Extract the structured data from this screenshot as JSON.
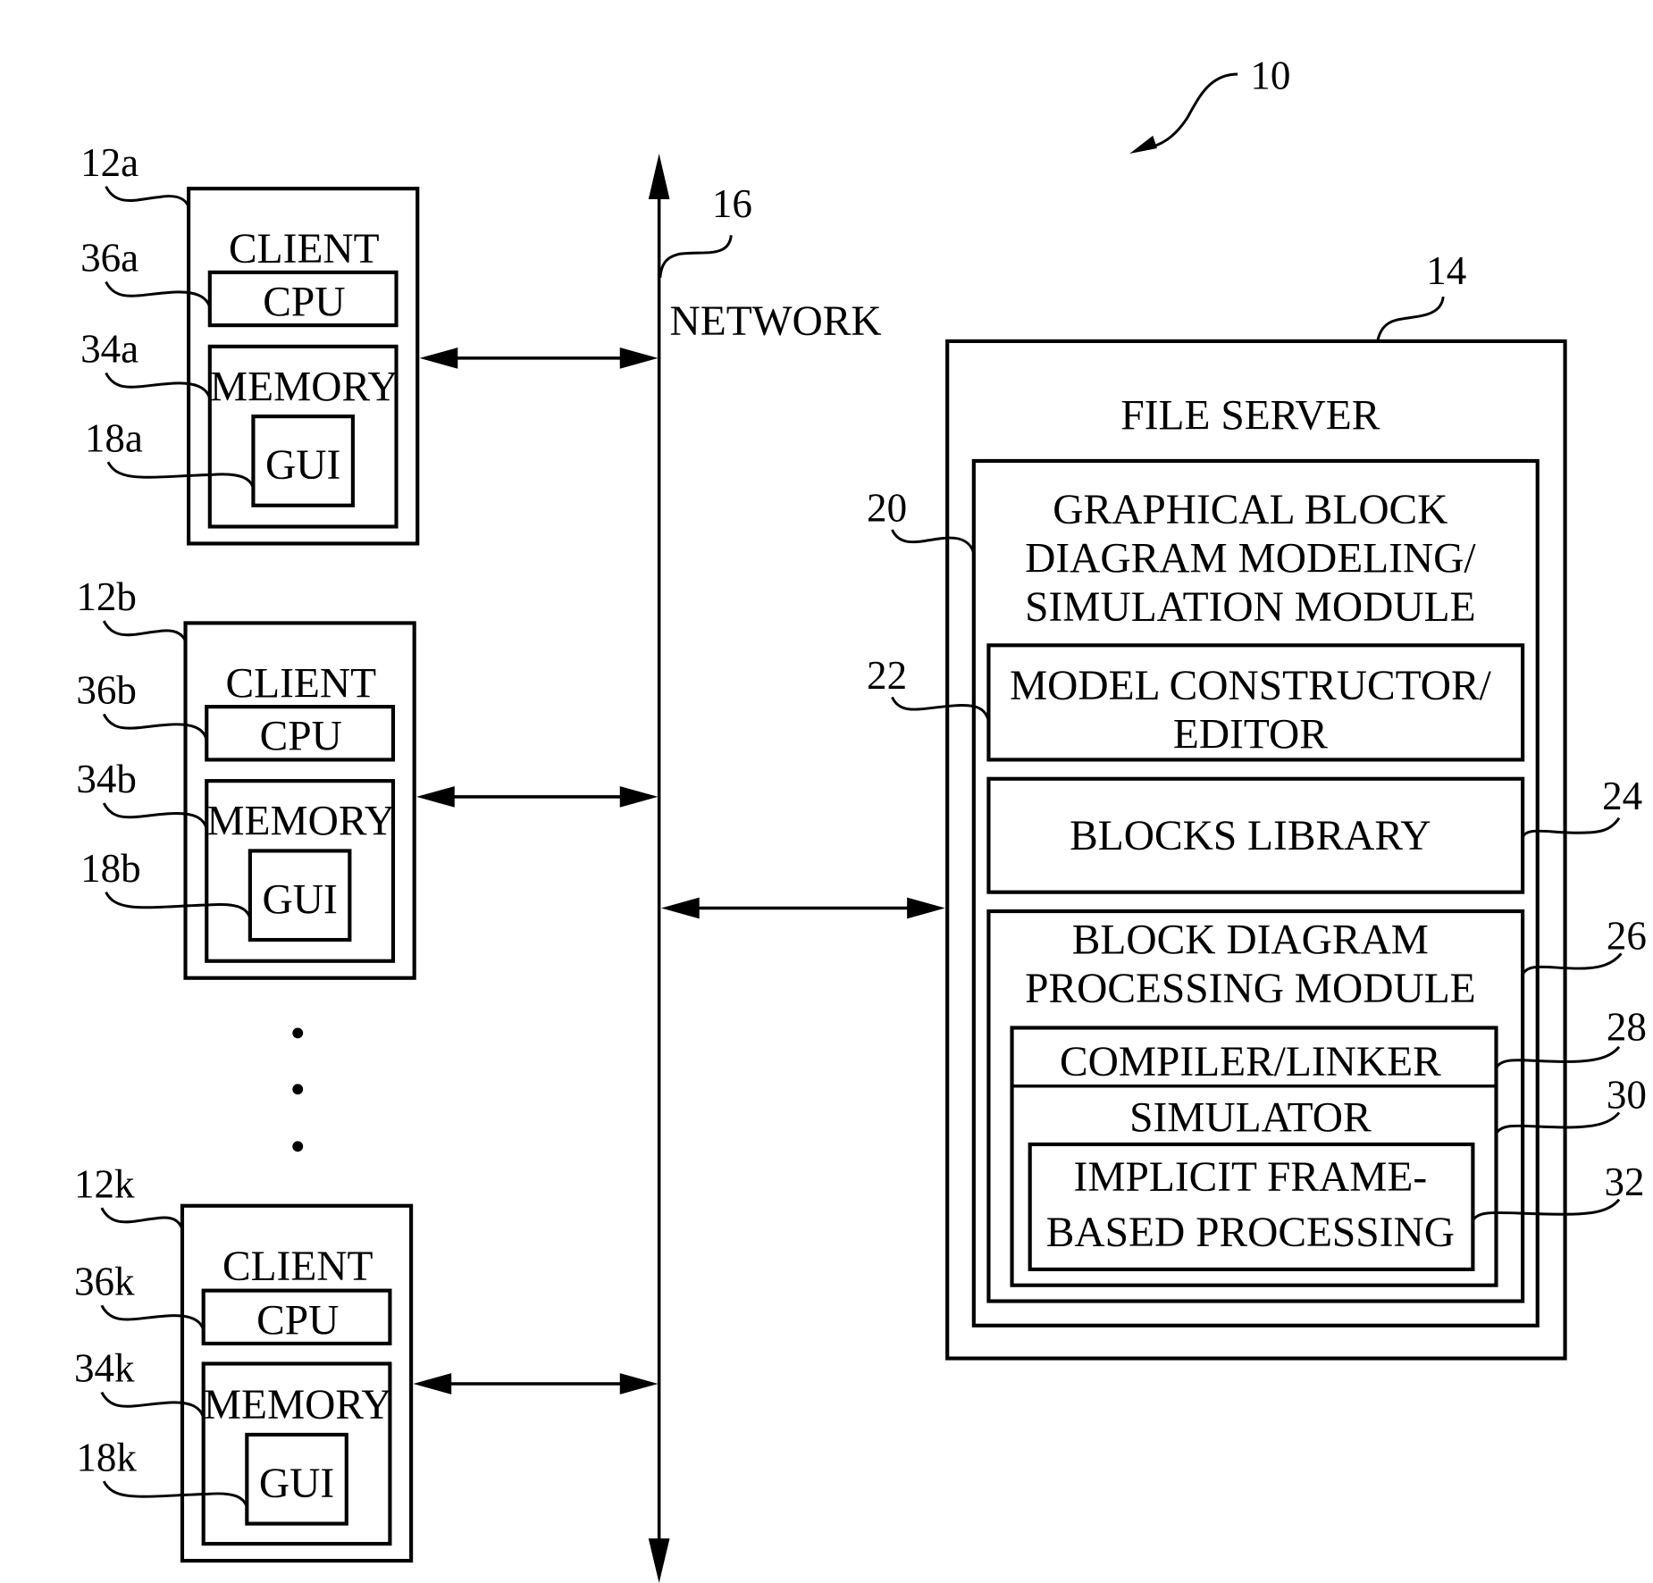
{
  "figure": {
    "system_ref": "10",
    "network": {
      "label": "NETWORK",
      "ref": "16"
    },
    "clients": [
      {
        "ref": "12a",
        "title": "CLIENT",
        "cpu": {
          "label": "CPU",
          "ref": "36a"
        },
        "memory": {
          "label": "MEMORY",
          "ref": "34a"
        },
        "gui": {
          "label": "GUI",
          "ref": "18a"
        }
      },
      {
        "ref": "12b",
        "title": "CLIENT",
        "cpu": {
          "label": "CPU",
          "ref": "36b"
        },
        "memory": {
          "label": "MEMORY",
          "ref": "34b"
        },
        "gui": {
          "label": "GUI",
          "ref": "18b"
        }
      },
      {
        "ref": "12k",
        "title": "CLIENT",
        "cpu": {
          "label": "CPU",
          "ref": "36k"
        },
        "memory": {
          "label": "MEMORY",
          "ref": "34k"
        },
        "gui": {
          "label": "GUI",
          "ref": "18k"
        }
      }
    ],
    "ellipsis": "...",
    "file_server": {
      "ref": "14",
      "title": "FILE SERVER",
      "modeling_module": {
        "ref": "20",
        "lines": [
          "GRAPHICAL BLOCK",
          "DIAGRAM MODELING/",
          "SIMULATION MODULE"
        ]
      },
      "model_constructor": {
        "ref": "22",
        "lines": [
          "MODEL CONSTRUCTOR/",
          "EDITOR"
        ]
      },
      "blocks_library": {
        "ref": "24",
        "label": "BLOCKS LIBRARY"
      },
      "processing_module": {
        "ref": "26",
        "lines": [
          "BLOCK DIAGRAM",
          "PROCESSING MODULE"
        ]
      },
      "compiler_linker": {
        "ref": "28",
        "label": "COMPILER/LINKER"
      },
      "simulator": {
        "ref": "30",
        "label": "SIMULATOR"
      },
      "implicit_processing": {
        "ref": "32",
        "lines": [
          "IMPLICIT FRAME-",
          "BASED PROCESSING"
        ]
      }
    }
  }
}
